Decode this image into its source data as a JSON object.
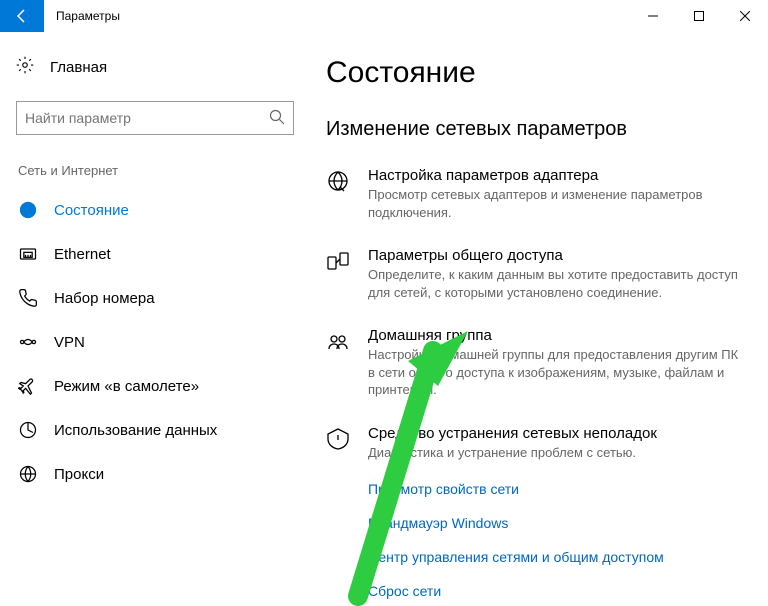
{
  "titlebar": {
    "app_title": "Параметры"
  },
  "sidebar": {
    "home_label": "Главная",
    "search_placeholder": "Найти параметр",
    "category_label": "Сеть и Интернет",
    "items": [
      {
        "label": "Состояние"
      },
      {
        "label": "Ethernet"
      },
      {
        "label": "Набор номера"
      },
      {
        "label": "VPN"
      },
      {
        "label": "Режим «в самолете»"
      },
      {
        "label": "Использование данных"
      },
      {
        "label": "Прокси"
      }
    ]
  },
  "main": {
    "page_title": "Состояние",
    "section_title": "Изменение сетевых параметров",
    "settings": [
      {
        "name": "Настройка параметров адаптера",
        "desc": "Просмотр сетевых адаптеров и изменение параметров подключения."
      },
      {
        "name": "Параметры общего доступа",
        "desc": "Определите, к каким данным вы хотите предоставить доступ для сетей, с которыми установлено соединение."
      },
      {
        "name": "Домашняя группа",
        "desc": "Настройка домашней группы для предоставления другим ПК в сети общего доступа к изображениям, музыке, файлам и принтерам."
      },
      {
        "name": "Средство устранения сетевых неполадок",
        "desc": "Диагностика и устранение проблем с сетью."
      }
    ],
    "links": [
      "Просмотр свойств сети",
      "Брандмауэр Windows",
      "Центр управления сетями и общим доступом",
      "Сброс сети"
    ]
  }
}
